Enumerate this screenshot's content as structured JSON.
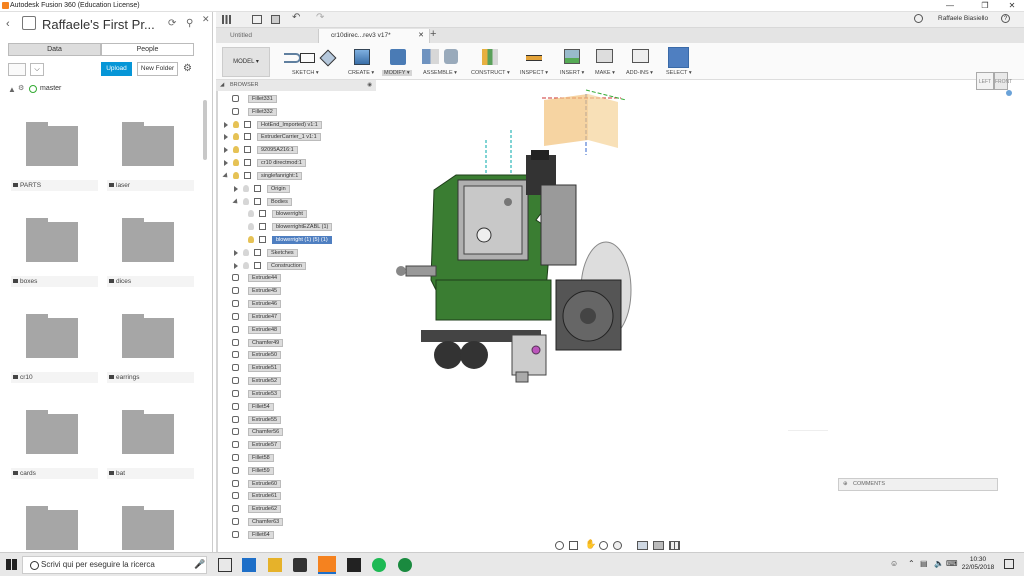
{
  "window": {
    "title": "Autodesk Fusion 360 (Education License)"
  },
  "data_panel": {
    "project_title": "Raffaele's First Pr...",
    "tabs": [
      "Data",
      "People"
    ],
    "upload_label": "Upload",
    "new_folder_label": "New Folder",
    "branch": "master",
    "folders": [
      "PARTS",
      "laser",
      "boxes",
      "dices",
      "cr10",
      "earrings",
      "cards",
      "bat",
      "",
      ""
    ]
  },
  "toolbar": {
    "user": "Raffaele Biasiello",
    "tabs": [
      {
        "label": "Untitled"
      },
      {
        "label": "cr10direc...rev3 v17*"
      }
    ],
    "workspace": "MODEL",
    "groups": [
      "SKETCH",
      "CREATE",
      "MODIFY",
      "ASSEMBLE",
      "CONSTRUCT",
      "INSPECT",
      "INSERT",
      "MAKE",
      "ADD-INS",
      "SELECT"
    ]
  },
  "browser": {
    "title": "BROWSER",
    "nodes": [
      {
        "label": "Fillet331",
        "depth": 0,
        "kind": "feature"
      },
      {
        "label": "Fillet332",
        "depth": 0,
        "kind": "feature"
      },
      {
        "label": "HotEnd_Imported) v1:1",
        "depth": 0,
        "kind": "component"
      },
      {
        "label": "ExtruderCarrier_1 v1:1",
        "depth": 0,
        "kind": "component"
      },
      {
        "label": "92095A216:1",
        "depth": 0,
        "kind": "component"
      },
      {
        "label": "cr10 directmod:1",
        "depth": 0,
        "kind": "component"
      },
      {
        "label": "singlefanright:1",
        "depth": 0,
        "kind": "component"
      },
      {
        "label": "Origin",
        "depth": 1,
        "kind": "folder"
      },
      {
        "label": "Bodies",
        "depth": 1,
        "kind": "folder"
      },
      {
        "label": "blowerright",
        "depth": 2,
        "kind": "body"
      },
      {
        "label": "blowerrightEZABL (1)",
        "depth": 2,
        "kind": "body"
      },
      {
        "label": "blowerright (1) (5) (1)",
        "depth": 2,
        "kind": "body-selected"
      },
      {
        "label": "Sketches",
        "depth": 1,
        "kind": "folder"
      },
      {
        "label": "Construction",
        "depth": 1,
        "kind": "folder"
      },
      {
        "label": "Extrude44",
        "depth": 0,
        "kind": "feature"
      },
      {
        "label": "Extrude45",
        "depth": 0,
        "kind": "feature"
      },
      {
        "label": "Extrude46",
        "depth": 0,
        "kind": "feature"
      },
      {
        "label": "Extrude47",
        "depth": 0,
        "kind": "feature"
      },
      {
        "label": "Extrude48",
        "depth": 0,
        "kind": "feature"
      },
      {
        "label": "Chamfer49",
        "depth": 0,
        "kind": "feature"
      },
      {
        "label": "Extrude50",
        "depth": 0,
        "kind": "feature"
      },
      {
        "label": "Extrude51",
        "depth": 0,
        "kind": "feature"
      },
      {
        "label": "Extrude52",
        "depth": 0,
        "kind": "feature"
      },
      {
        "label": "Extrude53",
        "depth": 0,
        "kind": "feature"
      },
      {
        "label": "Fillet54",
        "depth": 0,
        "kind": "feature"
      },
      {
        "label": "Extrude55",
        "depth": 0,
        "kind": "feature"
      },
      {
        "label": "Chamfer56",
        "depth": 0,
        "kind": "feature"
      },
      {
        "label": "Extrude57",
        "depth": 0,
        "kind": "feature"
      },
      {
        "label": "Fillet58",
        "depth": 0,
        "kind": "feature"
      },
      {
        "label": "Fillet59",
        "depth": 0,
        "kind": "feature"
      },
      {
        "label": "Extrude60",
        "depth": 0,
        "kind": "feature"
      },
      {
        "label": "Extrude61",
        "depth": 0,
        "kind": "feature"
      },
      {
        "label": "Extrude62",
        "depth": 0,
        "kind": "feature"
      },
      {
        "label": "Chamfer63",
        "depth": 0,
        "kind": "feature"
      },
      {
        "label": "Fillet64",
        "depth": 0,
        "kind": "feature"
      }
    ]
  },
  "viewcube": {
    "left": "LEFT",
    "front": "FRONT"
  },
  "comments_label": "COMMENTS",
  "taskbar": {
    "search_placeholder": "Scrivi qui per eseguire la ricerca",
    "time": "10:30",
    "date": "22/05/2018"
  },
  "colors": {
    "accent": "#0696d7",
    "selection": "#4f7fc1",
    "model_green": "#3a7d32"
  }
}
